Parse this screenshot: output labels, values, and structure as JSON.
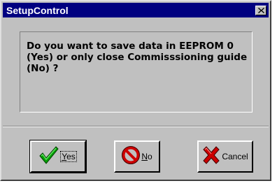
{
  "window": {
    "title": "SetupControl"
  },
  "icons": {
    "close": "close-icon",
    "yes": "checkmark-icon",
    "no": "no-entry-icon",
    "cancel": "x-cancel-icon"
  },
  "message": {
    "text": "Do you want to save data in EEPROM 0\n(Yes) or only close Commisssioning guide\n(No) ?"
  },
  "buttons": {
    "yes": {
      "mnemonic": "Y",
      "rest": "es"
    },
    "no": {
      "mnemonic": "N",
      "rest": "o"
    },
    "cancel": {
      "label": "Cancel"
    }
  },
  "colors": {
    "titlebar": "#000080",
    "face": "#c0c0c0",
    "check_green": "#008000",
    "no_red": "#cc0000"
  }
}
